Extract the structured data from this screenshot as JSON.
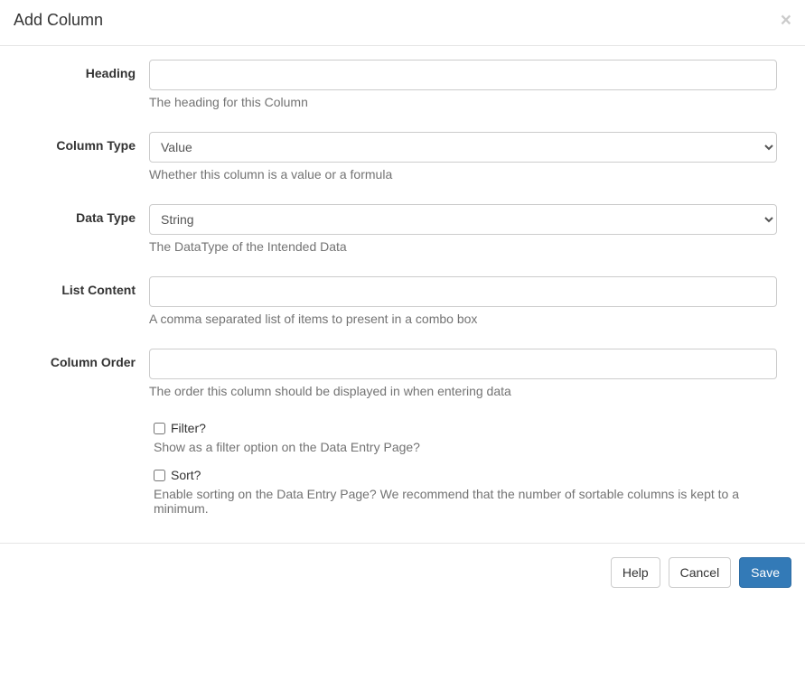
{
  "modal": {
    "title": "Add Column",
    "close_glyph": "×"
  },
  "fields": {
    "heading": {
      "label": "Heading",
      "value": "",
      "help": "The heading for this Column"
    },
    "columnType": {
      "label": "Column Type",
      "value": "Value",
      "help": "Whether this column is a value or a formula"
    },
    "dataType": {
      "label": "Data Type",
      "value": "String",
      "help": "The DataType of the Intended Data"
    },
    "listContent": {
      "label": "List Content",
      "value": "",
      "help": "A comma separated list of items to present in a combo box"
    },
    "columnOrder": {
      "label": "Column Order",
      "value": "",
      "help": "The order this column should be displayed in when entering data"
    },
    "filter": {
      "label": "Filter?",
      "checked": false,
      "help": "Show as a filter option on the Data Entry Page?"
    },
    "sort": {
      "label": "Sort?",
      "checked": false,
      "help": "Enable sorting on the Data Entry Page? We recommend that the number of sortable columns is kept to a minimum."
    }
  },
  "footer": {
    "help": "Help",
    "cancel": "Cancel",
    "save": "Save"
  }
}
